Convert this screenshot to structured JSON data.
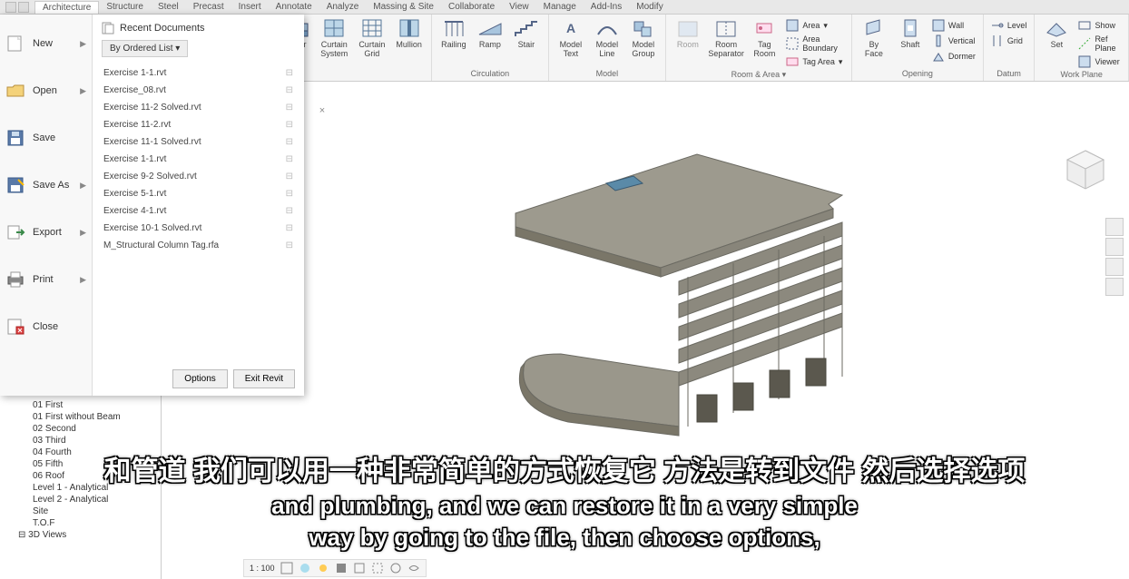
{
  "tabs": [
    "Architecture",
    "Structure",
    "Steel",
    "Precast",
    "Insert",
    "Annotate",
    "Analyze",
    "Massing & Site",
    "Collaborate",
    "View",
    "Manage",
    "Add-Ins",
    "Modify"
  ],
  "ribbon": {
    "build": {
      "floor": "Floor",
      "curtain_system": "Curtain\nSystem",
      "curtain_grid": "Curtain\nGrid",
      "mullion": "Mullion"
    },
    "circulation": {
      "railing": "Railing",
      "ramp": "Ramp",
      "stair": "Stair",
      "label": "Circulation"
    },
    "model": {
      "model_text": "Model\nText",
      "model_line": "Model\nLine",
      "model_group": "Model\nGroup",
      "label": "Model"
    },
    "room_area": {
      "room": "Room",
      "room_separator": "Room\nSeparator",
      "tag_room": "Tag\nRoom",
      "area": "Area",
      "area_boundary": "Area Boundary",
      "tag_area": "Tag Area",
      "label": "Room & Area ▾"
    },
    "opening": {
      "by_face": "By\nFace",
      "shaft": "Shaft",
      "wall": "Wall",
      "vertical": "Vertical",
      "dormer": "Dormer",
      "label": "Opening"
    },
    "datum": {
      "level": "Level",
      "grid": "Grid",
      "label": "Datum"
    },
    "workplane": {
      "set": "Set",
      "show": "Show",
      "ref_plane": "Ref Plane",
      "viewer": "Viewer",
      "label": "Work Plane"
    }
  },
  "file_menu": {
    "items": [
      {
        "label": "New",
        "arrow": true
      },
      {
        "label": "Open",
        "arrow": true
      },
      {
        "label": "Save",
        "arrow": false
      },
      {
        "label": "Save As",
        "arrow": true
      },
      {
        "label": "Export",
        "arrow": true
      },
      {
        "label": "Print",
        "arrow": true
      },
      {
        "label": "Close",
        "arrow": false
      }
    ],
    "recent_title": "Recent Documents",
    "ordered": "By Ordered List ▾",
    "recent": [
      "Exercise 1-1.rvt",
      "Exercise_08.rvt",
      "Exercise 11-2 Solved.rvt",
      "Exercise 11-2.rvt",
      "Exercise 11-1 Solved.rvt",
      "Exercise 1-1.rvt",
      "Exercise 9-2 Solved.rvt",
      "Exercise 5-1.rvt",
      "Exercise 4-1.rvt",
      "Exercise 10-1 Solved.rvt",
      "M_Structural Column Tag.rfa"
    ],
    "options_btn": "Options",
    "exit_btn": "Exit Revit"
  },
  "browser_nodes": [
    "01 First",
    "01 First without Beam",
    "02 Second",
    "03 Third",
    "04 Fourth",
    "05 Fifth",
    "06 Roof",
    "Level 1 - Analytical",
    "Level 2 - Analytical",
    "Site",
    "T.O.F"
  ],
  "browser_3d": "3D Views",
  "status": {
    "scale": "1 : 100"
  },
  "close_x": "×",
  "subtitles": {
    "cn": "和管道 我们可以用一种非常简单的方式恢复它 方法是转到文件 然后选择选项",
    "en1": "and plumbing, and we can restore it in a very simple",
    "en2": "way by going to the file, then choose options,"
  }
}
